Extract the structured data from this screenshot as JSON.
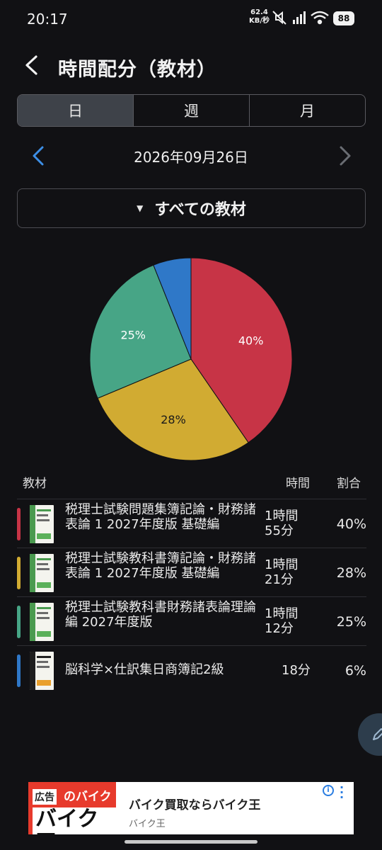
{
  "status_bar": {
    "time": "20:17",
    "net_speed": "62.4",
    "net_unit": "KB/秒",
    "battery": "88"
  },
  "header": {
    "title": "時間配分（教材）"
  },
  "tabs": [
    {
      "label": "日",
      "active": true
    },
    {
      "label": "週",
      "active": false
    },
    {
      "label": "月",
      "active": false
    }
  ],
  "date_nav": {
    "date": "2026年09月26日"
  },
  "filter": {
    "label": "すべての教材"
  },
  "chart_data": {
    "type": "pie",
    "slices": [
      {
        "label": "税理士試験問題集簿記論・財務諸表論 1 2027年度版 基礎編",
        "value": 40,
        "color": "#c73446",
        "display": "40%"
      },
      {
        "label": "税理士試験教科書簿記論・財務諸表論 1 2027年度版 基礎編",
        "value": 28,
        "color": "#d1ab32",
        "display": "28%"
      },
      {
        "label": "税理士試験教科書財務諸表論 理論編 2027年度版",
        "value": 25,
        "color": "#47a586",
        "display": "25%"
      },
      {
        "label": "脳科学×仕訳集日商簿記2級",
        "value": 6,
        "color": "#2f78c8",
        "display": ""
      }
    ]
  },
  "table": {
    "headers": {
      "material": "教材",
      "time": "時間",
      "ratio": "割合"
    },
    "rows": [
      {
        "name": "税理士試験問題集簿記論・財務諸表論 1 2027年度版 基礎編",
        "time": "1時間\n55分",
        "pct": "40%",
        "color": "#c73446"
      },
      {
        "name": "税理士試験教科書簿記論・財務諸表論 1 2027年度版 基礎編",
        "time": "1時間\n21分",
        "pct": "28%",
        "color": "#d1ab32"
      },
      {
        "name": "税理士試験教科書財務諸表論理論編 2027年度版",
        "time": "1時間\n12分",
        "pct": "25%",
        "color": "#47a586"
      },
      {
        "name": "脳科学×仕訳集日商簿記2級",
        "time": "18分",
        "pct": "6%",
        "color": "#2f78c8"
      }
    ]
  },
  "ad": {
    "badge": "広告",
    "image_line1": "のバイク",
    "image_line2": "バイク王",
    "title": "バイク買取ならバイク王",
    "advertiser": "バイク王",
    "info": "i"
  }
}
